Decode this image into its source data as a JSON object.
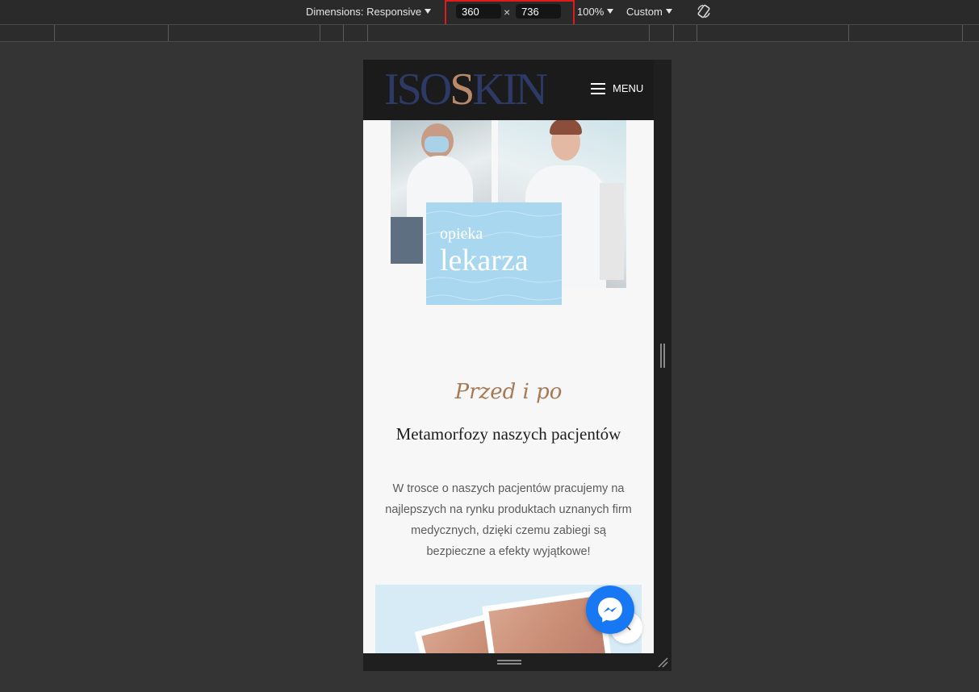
{
  "devtools": {
    "dimensions_label": "Dimensions: Responsive",
    "width_value": "360",
    "times_symbol": "×",
    "height_value": "736",
    "zoom_label": "100%",
    "throttle_label": "Custom",
    "highlight_color": "#e01b1b"
  },
  "site": {
    "logo_left": "ISO",
    "logo_accent": "S",
    "logo_right": "KIN",
    "menu_label": "MENU",
    "brand_colors": {
      "logo": "#2d3a66",
      "accent": "#b88a6a",
      "card": "#a9d7ef"
    }
  },
  "hero": {
    "card_small": "opieka",
    "card_big": "lekarza"
  },
  "section": {
    "script_title": "Przed i po",
    "title": "Metamorfozy naszych pacjentów",
    "description": "W trosce o naszych pacjentów pracujemy na najlepszych na rynku produktach uznanych firm medycznych, dzięki czemu zabiegi są bezpieczne a efekty wyjątkowe!"
  },
  "icons": {
    "menu": "hamburger-icon",
    "messenger": "messenger-icon",
    "scroll_top": "chevron-up-icon",
    "rotate": "rotate-device-icon"
  }
}
